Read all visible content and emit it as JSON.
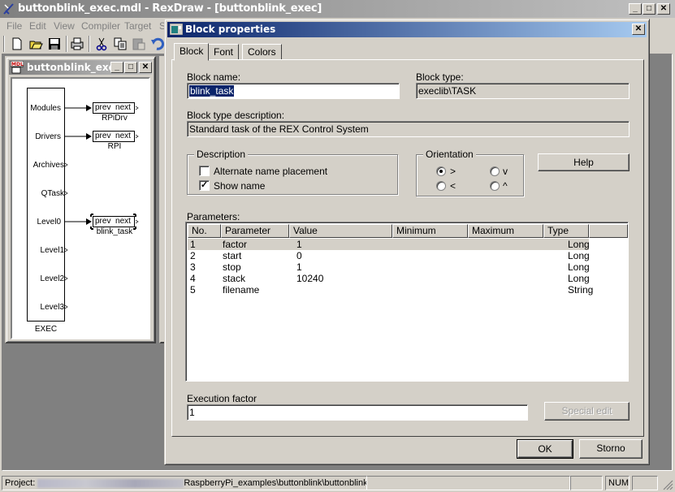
{
  "app": {
    "title": "buttonblink_exec.mdl - RexDraw - [buttonblink_exec]",
    "menu": [
      "File",
      "Edit",
      "View",
      "Compiler",
      "Target",
      "S"
    ],
    "toolbar_icons": [
      "new-file-icon",
      "open-folder-icon",
      "save-icon",
      "print-icon",
      "cut-icon",
      "copy-icon",
      "paste-icon",
      "undo-icon"
    ]
  },
  "child_window": {
    "title": "buttonblink_exec",
    "exec_block": {
      "name": "EXEC",
      "outputs": [
        "Modules",
        "Drivers",
        "Archives",
        "QTask",
        "Level0",
        "Level1",
        "Level2",
        "Level3"
      ]
    },
    "task_blocks": [
      {
        "name": "RPiDrv",
        "port_in": "prev",
        "port_out": "next",
        "connected_to": "Modules"
      },
      {
        "name": "RPI",
        "port_in": "prev",
        "port_out": "next",
        "connected_to": "Drivers"
      },
      {
        "name": "blink_task",
        "port_in": "prev",
        "port_out": "next",
        "connected_to": "Level0",
        "selected": true
      }
    ]
  },
  "dialog": {
    "title": "Block properties",
    "tabs": [
      {
        "label": "Block",
        "active": true
      },
      {
        "label": "Font"
      },
      {
        "label": "Colors"
      }
    ],
    "block_name_label": "Block name:",
    "block_name_value": "blink_task",
    "block_type_label": "Block type:",
    "block_type_value": "execlib\\TASK",
    "block_type_desc_label": "Block type description:",
    "block_type_desc_value": "Standard task of the REX Control System",
    "description_group": {
      "title": "Description",
      "alternate_name_label": "Alternate name placement",
      "alternate_name_checked": false,
      "show_name_label": "Show name",
      "show_name_checked": true
    },
    "orientation_group": {
      "title": "Orientation",
      "options": [
        {
          "label": ">",
          "selected": true
        },
        {
          "label": "v",
          "selected": false
        },
        {
          "label": "<",
          "selected": false
        },
        {
          "label": "^",
          "selected": false
        }
      ]
    },
    "help_label": "Help",
    "parameters_label": "Parameters:",
    "parameters": {
      "columns": [
        "No.",
        "Parameter",
        "Value",
        "Minimum",
        "Maximum",
        "Type"
      ],
      "rows": [
        {
          "no": "1",
          "parameter": "factor",
          "value": "1",
          "min": "",
          "max": "",
          "type": "Long"
        },
        {
          "no": "2",
          "parameter": "start",
          "value": "0",
          "min": "",
          "max": "",
          "type": "Long"
        },
        {
          "no": "3",
          "parameter": "stop",
          "value": "1",
          "min": "",
          "max": "",
          "type": "Long"
        },
        {
          "no": "4",
          "parameter": "stack",
          "value": "10240",
          "min": "",
          "max": "",
          "type": "Long"
        },
        {
          "no": "5",
          "parameter": "filename",
          "value": "",
          "min": "",
          "max": "",
          "type": "String"
        }
      ]
    },
    "exec_factor_label": "Execution factor",
    "exec_factor_value": "1",
    "special_edit_label": "Special edit",
    "ok_label": "OK",
    "cancel_label": "Storno"
  },
  "status": {
    "project_label": "Project:",
    "project_path_visible": "RaspberryPi_examples\\buttonblink\\buttonblink_exec.mdl",
    "num": "NUM"
  }
}
